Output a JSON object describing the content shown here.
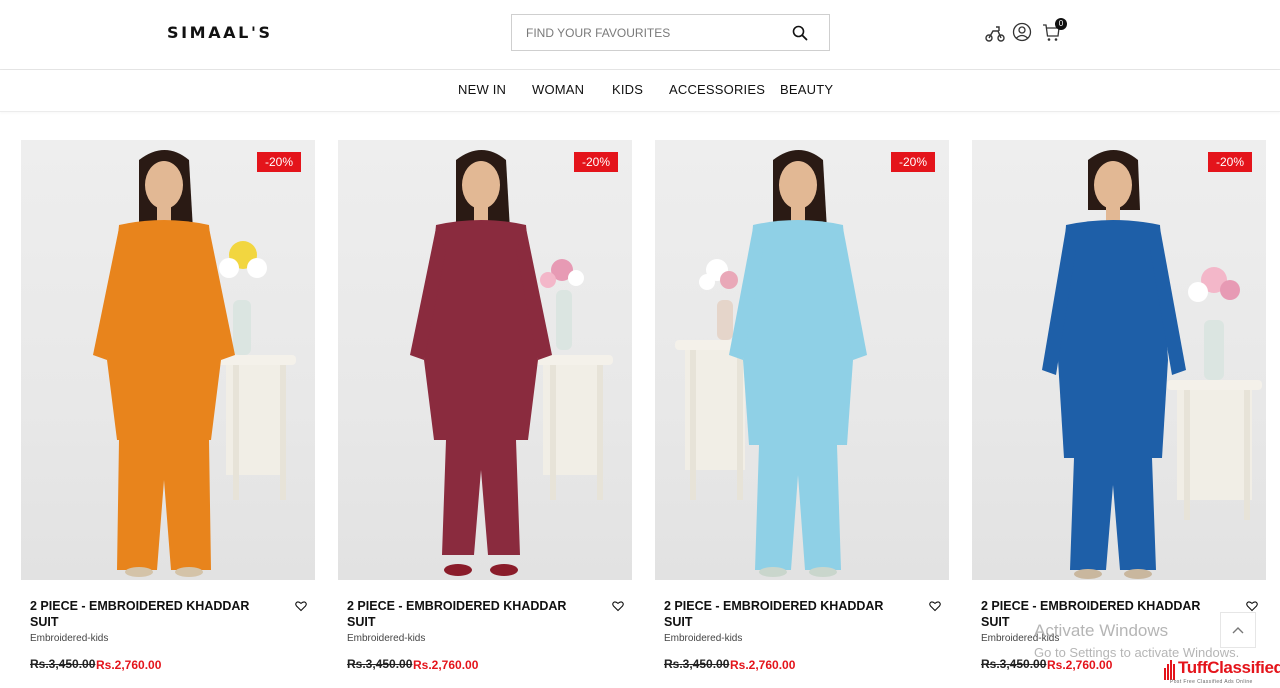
{
  "brand": {
    "logo": "SIMAAL'S"
  },
  "search": {
    "placeholder": "FIND YOUR FAVOURITES"
  },
  "header_icons": [
    "scooter-delivery-icon",
    "user-icon",
    "cart-icon"
  ],
  "cart": {
    "count": "0"
  },
  "nav": {
    "items": [
      "NEW IN",
      "WOMAN",
      "KIDS",
      "ACCESSORIES",
      "BEAUTY"
    ]
  },
  "products": [
    {
      "badge": "-20%",
      "title": "2 PIECE - EMBROIDERED KHADDAR SUIT",
      "category": "Embroidered-kids",
      "old_price": "Rs.3,450.00",
      "new_price": "Rs.2,760.00",
      "color": "#e8841c"
    },
    {
      "badge": "-20%",
      "title": "2 PIECE - EMBROIDERED KHADDAR SUIT",
      "category": "Embroidered-kids",
      "old_price": "Rs.3,450.00",
      "new_price": "Rs.2,760.00",
      "color": "#8a2b3e"
    },
    {
      "badge": "-20%",
      "title": "2 PIECE - EMBROIDERED KHADDAR SUIT",
      "category": "Embroidered-kids",
      "old_price": "Rs.3,450.00",
      "new_price": "Rs.2,760.00",
      "color": "#8fd0e6"
    },
    {
      "badge": "-20%",
      "title": "2 PIECE - EMBROIDERED KHADDAR SUIT",
      "category": "Embroidered-kids",
      "old_price": "Rs.3,450.00",
      "new_price": "Rs.2,760.00",
      "color": "#1e5fa8"
    }
  ],
  "overlay": {
    "activate_title": "Activate Windows",
    "activate_sub": "Go to Settings to activate Windows.",
    "watermark": "TuffClassified",
    "watermark_sub": "Post Free Classified Ads Online"
  },
  "colors": {
    "accent": "#e4141b",
    "text": "#111111"
  }
}
